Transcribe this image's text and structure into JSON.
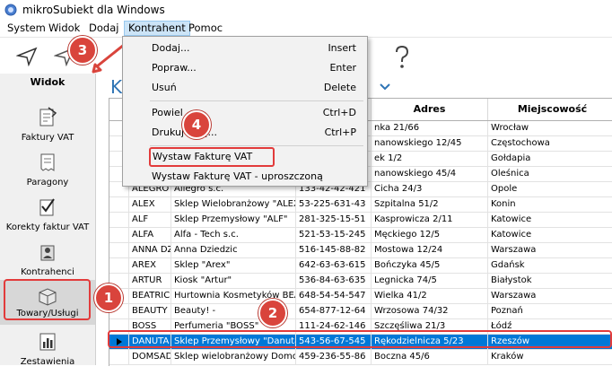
{
  "window": {
    "title": "mikroSubiekt dla Windows"
  },
  "menubar": {
    "items": [
      "System",
      "Widok",
      "Dodaj",
      "Kontrahent",
      "Pomoc"
    ]
  },
  "sidebar": {
    "header": "Widok",
    "items": [
      "Faktury VAT",
      "Paragony",
      "Korekty faktur VAT",
      "Kontrahenci",
      "Towary/Usługi",
      "Zestawienia"
    ]
  },
  "content": {
    "section_title": "K"
  },
  "dropdown": {
    "items": [
      {
        "label": "Dodaj...",
        "shortcut": "Insert"
      },
      {
        "label": "Popraw...",
        "shortcut": "Enter"
      },
      {
        "label": "Usuń",
        "shortcut": "Delete"
      },
      {
        "label": "Powiel",
        "shortcut": "Ctrl+D"
      },
      {
        "label": "Drukuj listę...",
        "shortcut": "Ctrl+P"
      },
      {
        "label": "Wystaw Fakturę VAT",
        "shortcut": ""
      },
      {
        "label": "Wystaw Fakturę VAT - uproszczoną",
        "shortcut": ""
      }
    ]
  },
  "grid": {
    "columns": [
      "",
      "",
      "",
      "Adres",
      "Miejscowość"
    ],
    "rows": [
      [
        "",
        "",
        "",
        "nka 21/66",
        "Wrocław"
      ],
      [
        "",
        "",
        "",
        "nanowskiego 12/45",
        "Częstochowa"
      ],
      [
        "",
        "",
        "",
        "ek 1/2",
        "Gołdapia"
      ],
      [
        "",
        "",
        "",
        "nanowskiego 45/4",
        "Oleśnica"
      ],
      [
        "ALEGRO",
        "Allegro s.c.",
        "133-42-42-421",
        "Cicha 24/3",
        "Opole"
      ],
      [
        "ALEX",
        "Sklep Wielobranżowy \"ALEX\"",
        "53-225-631-43",
        "Szpitalna 51/2",
        "Konin"
      ],
      [
        "ALF",
        "Sklep Przemysłowy \"ALF\"",
        "281-325-15-51",
        "Kasprowicza 2/11",
        "Katowice"
      ],
      [
        "ALFA",
        "Alfa - Tech s.c.",
        "521-53-15-245",
        "Męckiego 12/5",
        "Katowice"
      ],
      [
        "ANNA DZ",
        "Anna Dziedzic",
        "516-145-88-82",
        "Mostowa 12/24",
        "Warszawa"
      ],
      [
        "AREX",
        "Sklep \"Arex\"",
        "642-63-63-615",
        "Bończyka 45/5",
        "Gdańsk"
      ],
      [
        "ARTUR",
        "Kiosk \"Artur\"",
        "536-84-63-635",
        "Legnicka 74/5",
        "Białystok"
      ],
      [
        "BEATRIC",
        "Hurtownia Kosmetyków BEAT",
        "648-54-54-547",
        "Wielka 41/2",
        "Warszawa"
      ],
      [
        "BEAUTY",
        "Beauty! -",
        "654-877-12-64",
        "Wrzosowa 74/32",
        "Poznań"
      ],
      [
        "BOSS",
        "Perfumeria \"BOSS\"",
        "111-24-62-146",
        "Szczęśliwa 21/3",
        "Łódź"
      ],
      [
        "DANUTA",
        "Sklep Przemysłowy \"Danuta\"",
        "543-56-67-545",
        "Rękodzielnicza 5/23",
        "Rzeszów"
      ],
      [
        "DOMSAD",
        "Sklep wielobranżowy Domosa",
        "459-236-55-86",
        "Boczna 45/6",
        "Kraków"
      ]
    ]
  },
  "badges": [
    "1",
    "2",
    "3",
    "4"
  ],
  "colors": {
    "accent": "#2e74b5",
    "selection": "#0078d7",
    "callout": "#d9443c"
  }
}
